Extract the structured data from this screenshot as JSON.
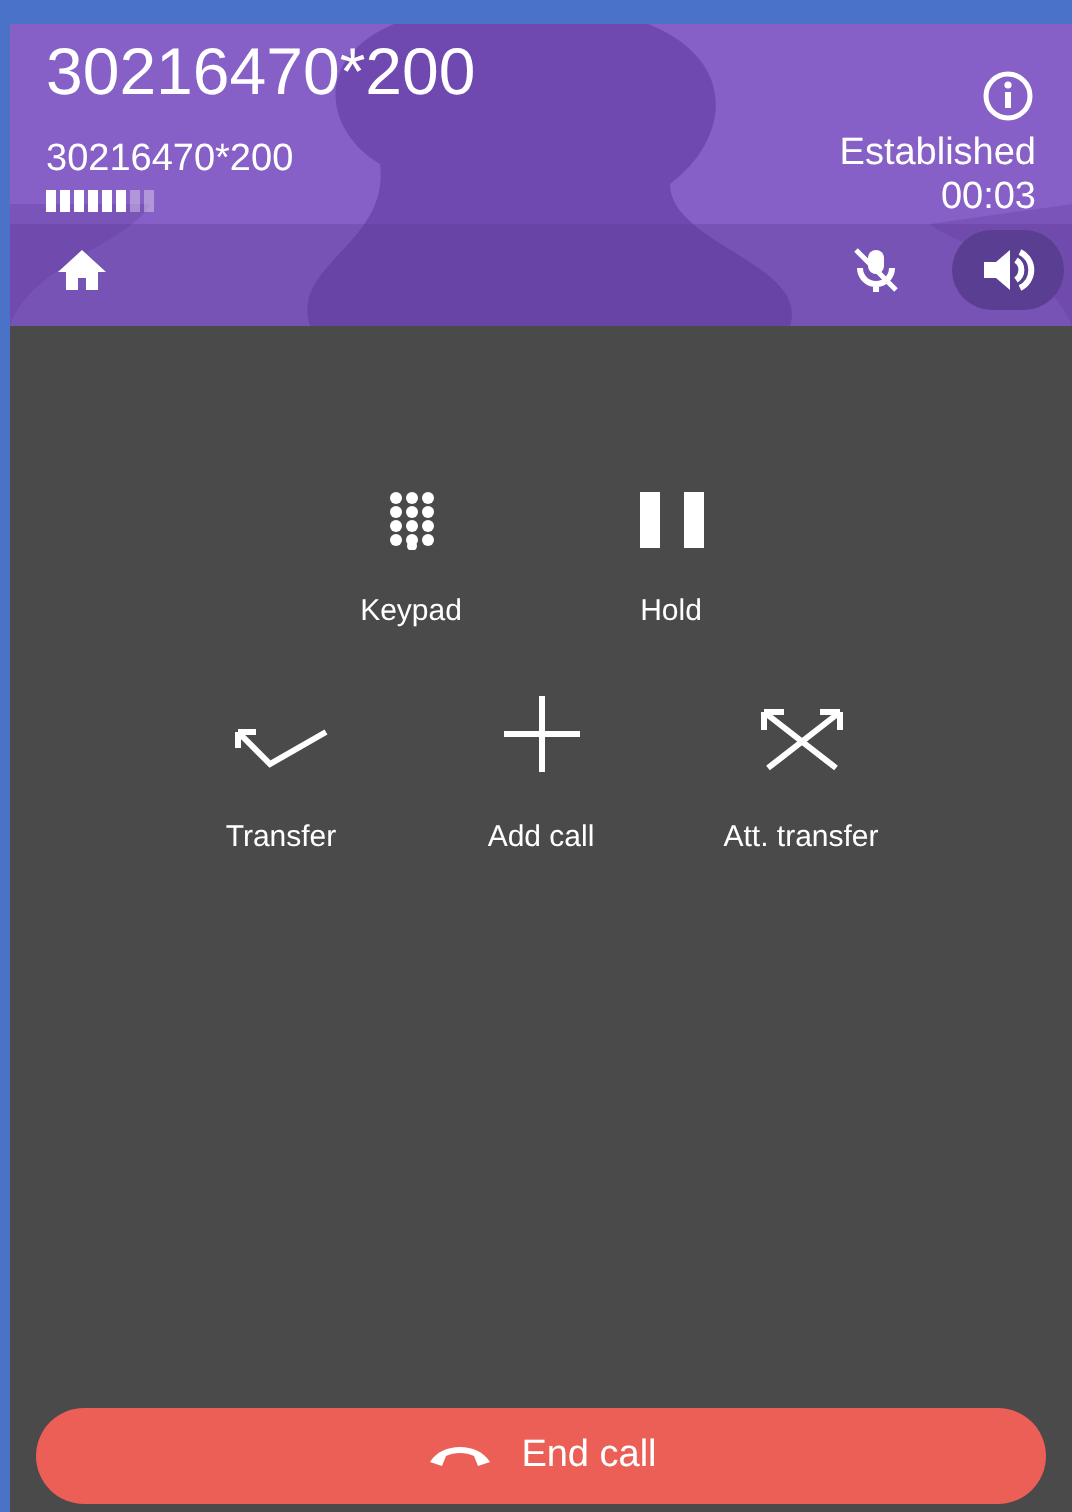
{
  "call": {
    "title": "30216470*200",
    "subtitle": "30216470*200",
    "quality": {
      "level": 0.75
    },
    "status": "Established",
    "duration": "00:03"
  },
  "controls": [
    {
      "kind": "home",
      "on": false
    },
    {
      "kind": "mute",
      "on": false
    },
    {
      "kind": "speaker",
      "on": true
    }
  ],
  "action_rows": [
    [
      {
        "kind": "keypad",
        "label": "Keypad"
      },
      {
        "kind": "hold",
        "label": "Hold"
      }
    ],
    [
      {
        "kind": "transfer",
        "label": "Transfer"
      },
      {
        "kind": "add",
        "label": "Add call"
      },
      {
        "kind": "att-transfer",
        "label": "Att. transfer"
      }
    ]
  ],
  "end_button": {
    "label": "End call"
  }
}
